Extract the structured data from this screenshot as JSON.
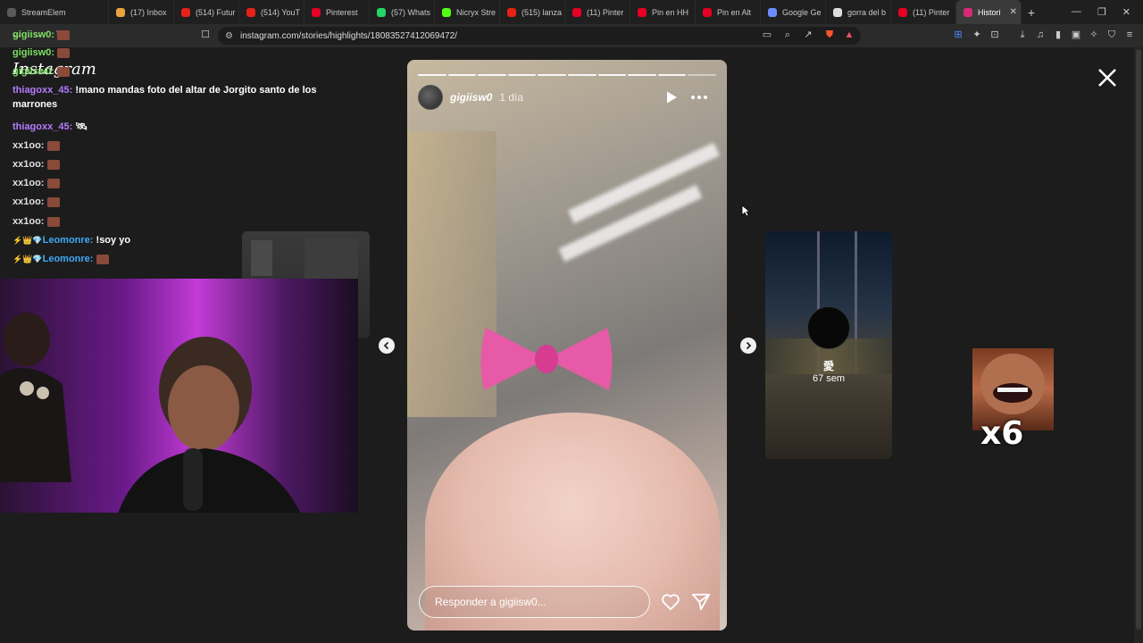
{
  "browser": {
    "tabs": [
      {
        "label": "StreamElem",
        "color": "#5a5a5a"
      },
      {
        "label": "(17) Inbox",
        "color": "#e8a33c"
      },
      {
        "label": "(514) Futur",
        "color": "#e62117"
      },
      {
        "label": "(514) YouT",
        "color": "#e62117"
      },
      {
        "label": "Pinterest",
        "color": "#e60023"
      },
      {
        "label": "(57) Whats",
        "color": "#25d366"
      },
      {
        "label": "Nicryx Stre",
        "color": "#53fc18"
      },
      {
        "label": "(515) lanza",
        "color": "#e62117"
      },
      {
        "label": "(11) Pinter",
        "color": "#e60023"
      },
      {
        "label": "Pin en HH",
        "color": "#e60023"
      },
      {
        "label": "Pin en Alt",
        "color": "#e60023"
      },
      {
        "label": "Google Ge",
        "color": "#6f8cff"
      },
      {
        "label": "gorra del b",
        "color": "#dddddd"
      },
      {
        "label": "(11) Pinter",
        "color": "#e60023"
      },
      {
        "label": "Histori",
        "color": "#d62976"
      }
    ],
    "url": "instagram.com/stories/highlights/18083527412069472/"
  },
  "chat": {
    "messages": [
      {
        "user": "gigiisw0:",
        "text": "",
        "color": "#7ddf64"
      },
      {
        "user": "gigiisw0:",
        "text": "",
        "color": "#7ddf64"
      },
      {
        "user": "gigiisw0:",
        "text": "",
        "color": "#7ddf64"
      },
      {
        "user": "thiagoxx_45:",
        "text": "!mano mandas foto del altar de Jorgito santo de los marrones",
        "color": "#b57bff"
      },
      {
        "user": "thiagoxx_45:",
        "text": "🛰",
        "color": "#b57bff"
      },
      {
        "user": "xx1oo:",
        "text": "",
        "color": "#e0e0e0"
      },
      {
        "user": "xx1oo:",
        "text": "",
        "color": "#e0e0e0"
      },
      {
        "user": "xx1oo:",
        "text": "",
        "color": "#e0e0e0"
      },
      {
        "user": "xx1oo:",
        "text": "",
        "color": "#e0e0e0"
      },
      {
        "user": "xx1oo:",
        "text": "",
        "color": "#e0e0e0"
      },
      {
        "user": "Leomonre:",
        "text": "!soy yo",
        "color": "#3fa9f5"
      },
      {
        "user": "Leomonre:",
        "text": "",
        "color": "#3fa9f5"
      }
    ]
  },
  "page": {
    "logo": "Instagram"
  },
  "story": {
    "username": "gigiisw0",
    "time": "1 día",
    "reply_placeholder": "Responder a gigiisw0...",
    "segments_total": 10,
    "segments_filled": 9
  },
  "preview_next": {
    "name": "愛",
    "time": "67 sem"
  },
  "emote_overlay": {
    "count": "x6"
  }
}
